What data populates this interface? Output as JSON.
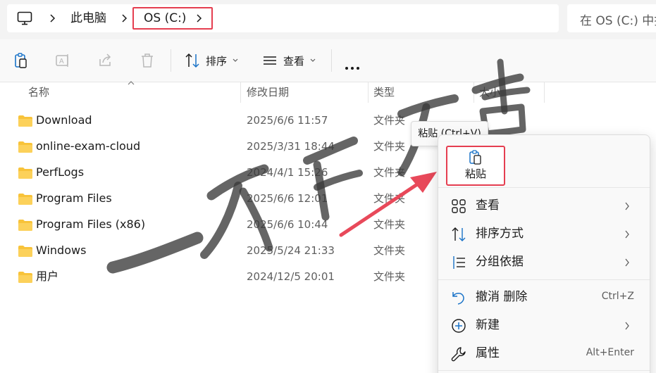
{
  "breadcrumb": {
    "items": [
      "此电脑",
      "OS (C:)"
    ]
  },
  "search": {
    "placeholder": "在 OS (C:) 中搜索"
  },
  "toolbar": {
    "sort_label": "排序",
    "view_label": "查看"
  },
  "columns": {
    "name": "名称",
    "modified": "修改日期",
    "type": "类型",
    "size": "大小"
  },
  "files": [
    {
      "name": "Download",
      "modified": "2025/6/6 11:57",
      "type": "文件夹"
    },
    {
      "name": "online-exam-cloud",
      "modified": "2025/3/31 18:44",
      "type": "文件夹"
    },
    {
      "name": "PerfLogs",
      "modified": "2024/4/1 15:26",
      "type": "文件夹"
    },
    {
      "name": "Program Files",
      "modified": "2025/6/6 12:01",
      "type": "文件夹"
    },
    {
      "name": "Program Files (x86)",
      "modified": "2025/6/6 10:44",
      "type": "文件夹"
    },
    {
      "name": "Windows",
      "modified": "2025/5/24 21:33",
      "type": "文件夹"
    },
    {
      "name": "用户",
      "modified": "2024/12/5 20:01",
      "type": "文件夹"
    }
  ],
  "tooltip": {
    "text": "粘贴 (Ctrl+V)"
  },
  "context_menu": {
    "paste_label": "粘贴",
    "items": [
      {
        "label": "查看",
        "icon": "grid-view-icon",
        "submenu": true
      },
      {
        "label": "排序方式",
        "icon": "sort-icon",
        "submenu": true
      },
      {
        "label": "分组依据",
        "icon": "group-by-icon",
        "submenu": true
      },
      {
        "label": "撤消 删除",
        "icon": "undo-icon",
        "shortcut": "Ctrl+Z"
      },
      {
        "label": "新建",
        "icon": "new-plus-icon",
        "submenu": true
      },
      {
        "label": "属性",
        "icon": "wrench-icon",
        "shortcut": "Alt+Enter"
      }
    ]
  },
  "watermark": {
    "text": "一介白衣青用"
  },
  "colors": {
    "highlight_border": "#e53e50",
    "folder_yellow": "#f8c33a",
    "arrow_red": "#e8495a",
    "accent_blue": "#1a73c8"
  }
}
